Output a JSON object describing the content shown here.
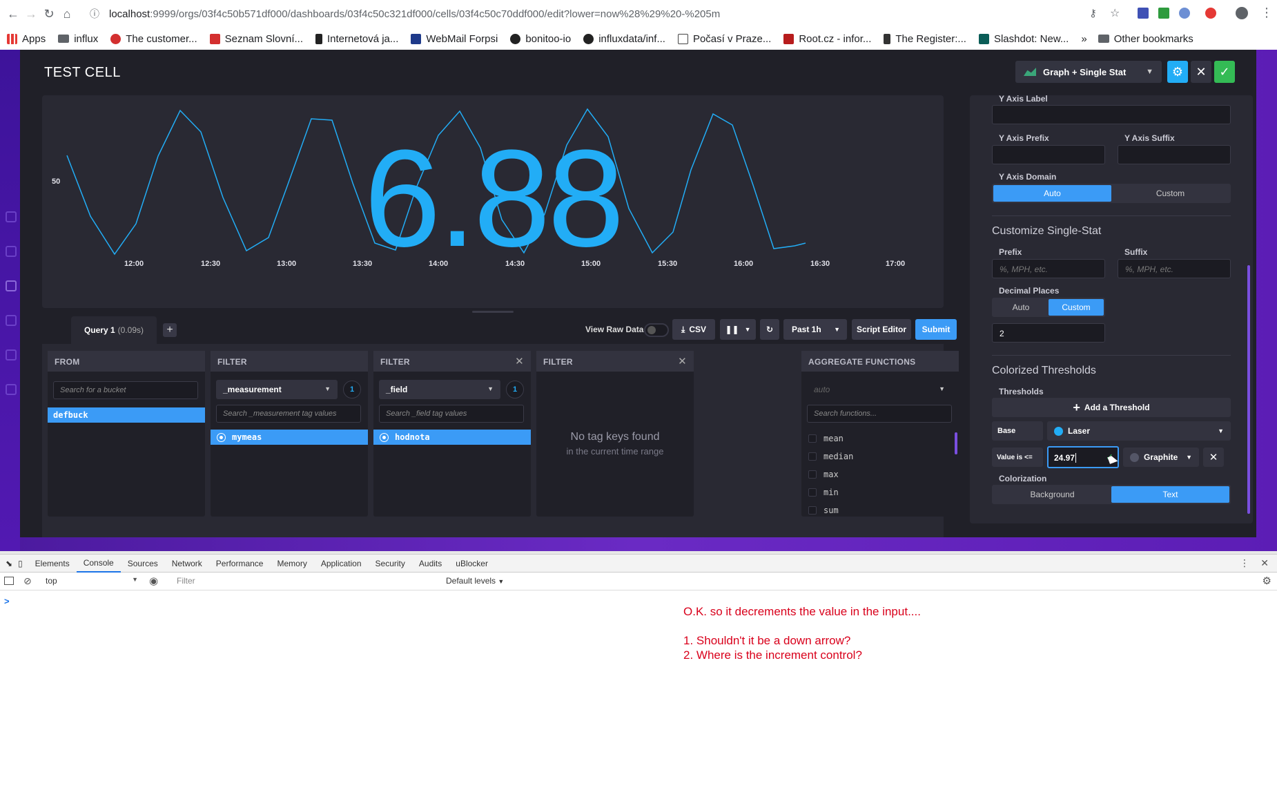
{
  "browser": {
    "url_host": "localhost",
    "url_rest": ":9999/orgs/03f4c50b571df000/dashboards/03f4c50c321df000/cells/03f4c50c70ddf000/edit?lower=now%28%29%20-%205m",
    "bookmarks": [
      "Apps",
      "influx",
      "The customer...",
      "Seznam Slovní...",
      "Internetová ja...",
      "WebMail Forpsi",
      "bonitoo-io",
      "influxdata/inf...",
      "Počasí v Praze...",
      "Root.cz - infor...",
      "The Register:...",
      "Slashdot: New..."
    ],
    "other_bookmarks": "Other bookmarks"
  },
  "header": {
    "title": "TEST CELL",
    "viz_type": "Graph + Single Stat"
  },
  "graph": {
    "y_tick": "50",
    "x_ticks": [
      "12:00",
      "12:30",
      "13:00",
      "13:30",
      "14:00",
      "14:30",
      "15:00",
      "15:30",
      "16:00",
      "16:30",
      "17:00"
    ],
    "single_stat": "6.88",
    "line_color": "#22adf6"
  },
  "query": {
    "tab_label": "Query 1",
    "tab_time": "(0.09s)",
    "view_raw": "View Raw Data",
    "csv": "CSV",
    "range": "Past 1h",
    "script_editor": "Script Editor",
    "submit": "Submit",
    "from": {
      "header": "FROM",
      "search_placeholder": "Search for a bucket",
      "selected": "defbuck"
    },
    "filter1": {
      "header": "FILTER",
      "key": "_measurement",
      "count": "1",
      "search_placeholder": "Search _measurement tag values",
      "selected": "mymeas"
    },
    "filter2": {
      "header": "FILTER",
      "key": "_field",
      "count": "1",
      "search_placeholder": "Search _field tag values",
      "selected": "hodnota"
    },
    "filter3": {
      "header": "FILTER",
      "empty_title": "No tag keys found",
      "empty_sub": "in the current time range"
    },
    "aggregate": {
      "header": "AGGREGATE FUNCTIONS",
      "window": "auto",
      "search_placeholder": "Search functions...",
      "functions": [
        "mean",
        "median",
        "max",
        "min",
        "sum"
      ]
    }
  },
  "options": {
    "y_axis_label": "Y Axis Label",
    "y_axis_prefix": "Y Axis Prefix",
    "y_axis_suffix": "Y Axis Suffix",
    "y_axis_domain": "Y Axis Domain",
    "domain_auto": "Auto",
    "domain_custom": "Custom",
    "single_stat_head": "Customize Single-Stat",
    "prefix": "Prefix",
    "suffix": "Suffix",
    "prefix_placeholder": "%, MPH, etc.",
    "suffix_placeholder": "%, MPH, etc.",
    "decimal_places": "Decimal Places",
    "dec_auto": "Auto",
    "dec_custom": "Custom",
    "decimals_value": "2",
    "thresholds_head": "Colorized Thresholds",
    "thresholds": "Thresholds",
    "add_threshold": "Add a Threshold",
    "base": "Base",
    "base_color_name": "Laser",
    "base_color": "#22adf6",
    "value_is": "Value is <=",
    "threshold_value": "24.97",
    "threshold_color_name": "Graphite",
    "colorization": "Colorization",
    "col_background": "Background",
    "col_text": "Text"
  },
  "devtools": {
    "tabs": [
      "Elements",
      "Console",
      "Sources",
      "Network",
      "Performance",
      "Memory",
      "Application",
      "Security",
      "Audits",
      "uBlocker"
    ],
    "active_tab": "Console",
    "context": "top",
    "filter_placeholder": "Filter",
    "levels": "Default levels",
    "prompt": ">"
  },
  "annotation": {
    "line1": "O.K. so it decrements the value in the input....",
    "line2": "1. Shouldn't it be a down arrow?",
    "line3": "2. Where is the increment control?"
  }
}
